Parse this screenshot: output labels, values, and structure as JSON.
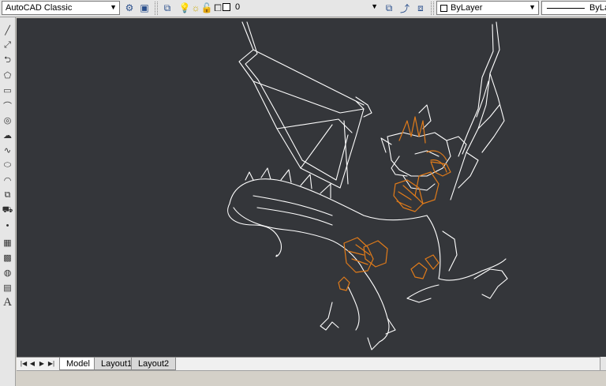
{
  "toolbar": {
    "workspace": "AutoCAD Classic",
    "layer_name": "0",
    "color_control": "ByLayer",
    "linetype_control": "ByLa",
    "icons": [
      "settings-icon",
      "workspace-icon",
      "layer-manager-icon",
      "lightbulb-icon",
      "sun-icon",
      "lock-icon",
      "layer-color-swatch",
      "layer-previous-icon",
      "layer-state-icon",
      "make-current-icon"
    ]
  },
  "palette": {
    "tools": [
      "line",
      "construction-line",
      "polyline",
      "polygon",
      "rectangle",
      "arc",
      "circle",
      "revision-cloud",
      "spline",
      "ellipse",
      "ellipse-arc",
      "insert-block",
      "make-block",
      "point",
      "hatch",
      "gradient",
      "region",
      "table",
      "multiline-text"
    ],
    "text_tool_label": "A"
  },
  "tabs": {
    "items": [
      {
        "label": "Model",
        "active": true
      },
      {
        "label": "Layout1",
        "active": false
      },
      {
        "label": "Layout2",
        "active": false
      }
    ]
  },
  "colors": {
    "canvas_bg": "#34363a",
    "linework": "#ffffff",
    "accent_hatch": "#e07b1a"
  }
}
